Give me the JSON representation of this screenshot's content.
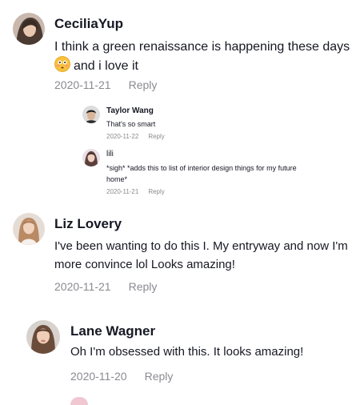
{
  "comments": [
    {
      "username": "CeciliaYup",
      "text": "I think a green renaissance is happening these days",
      "text_line2": "and i love it",
      "emoji": "flushed-face",
      "date": "2020-11-21",
      "reply_label": "Reply",
      "replies": [
        {
          "username": "Taylor Wang",
          "text": "That's so smart",
          "date": "2020-11-22",
          "reply_label": "Reply"
        },
        {
          "username": "lili",
          "text": "*sigh* *adds this to list of interior design things for my future home*",
          "date": "2020-11-21",
          "reply_label": "Reply"
        }
      ]
    },
    {
      "username": "Liz Lovery",
      "text": "I've been wanting to do this I. My entryway and now I'm more convince lol Looks amazing!",
      "date": "2020-11-21",
      "reply_label": "Reply"
    },
    {
      "username": "Lane Wagner",
      "text": "Oh I'm obsessed with this. It looks amazing!",
      "date": "2020-11-20",
      "reply_label": "Reply"
    }
  ],
  "colors": {
    "text": "#161823",
    "meta": "#8a8b91",
    "background": "#ffffff"
  }
}
